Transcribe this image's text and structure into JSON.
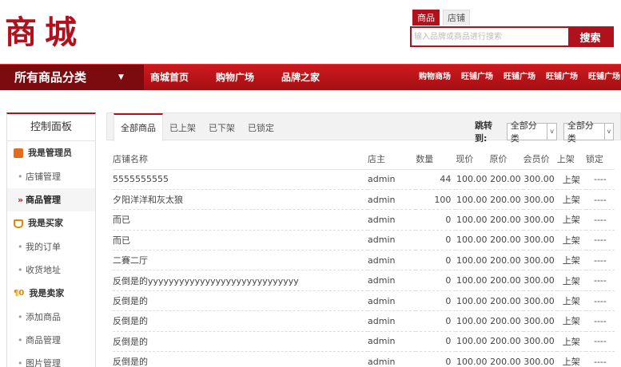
{
  "logo": {
    "text": "商城"
  },
  "search": {
    "tabs": [
      "商品",
      "店铺"
    ],
    "placeholder": "输入品牌或商品进行搜索",
    "button": "搜索"
  },
  "nav": {
    "all_categories": "所有商品分类",
    "main": [
      "商城首页",
      "购物广场",
      "品牌之家"
    ],
    "right": [
      "购物商场",
      "旺铺广场",
      "旺铺广场",
      "旺铺广场",
      "旺铺广场"
    ]
  },
  "sidebar": {
    "title": "控制面板",
    "groups": [
      {
        "label": "我是管理员",
        "icon": "manager-icon",
        "items": [
          "店铺管理",
          "商品管理"
        ]
      },
      {
        "label": "我是买家",
        "icon": "cart-icon",
        "items": [
          "我的订单",
          "收货地址"
        ]
      },
      {
        "label": "我是卖家",
        "icon": "seller-icon",
        "items": [
          "添加商品",
          "商品管理",
          "图片管理"
        ]
      }
    ],
    "active_item": "商品管理"
  },
  "main": {
    "tabs": [
      "全部商品",
      "已上架",
      "已下架",
      "已锁定"
    ],
    "jump_label": "跳转到:",
    "select1": "全部分类",
    "select2": "全部分类",
    "columns": [
      "店铺名称",
      "店主",
      "数量",
      "现价",
      "原价",
      "会员价",
      "上架",
      "锁定"
    ],
    "rows": [
      [
        "5555555555",
        "admin",
        "44",
        "100.00",
        "200.00",
        "300.00",
        "上架",
        "----"
      ],
      [
        "夕阳洋洋和灰太狼",
        "admin",
        "100",
        "100.00",
        "200.00",
        "300.00",
        "上架",
        "----"
      ],
      [
        "而已",
        "admin",
        "0",
        "100.00",
        "200.00",
        "300.00",
        "上架",
        "----"
      ],
      [
        "而已",
        "admin",
        "0",
        "100.00",
        "200.00",
        "300.00",
        "上架",
        "----"
      ],
      [
        "二賽二厅",
        "admin",
        "0",
        "100.00",
        "200.00",
        "300.00",
        "上架",
        "----"
      ],
      [
        "反倒是的yyyyyyyyyyyyyyyyyyyyyyyyyyyyy",
        "admin",
        "0",
        "100.00",
        "200.00",
        "300.00",
        "上架",
        "----"
      ],
      [
        "反倒是的",
        "admin",
        "0",
        "100.00",
        "200.00",
        "300.00",
        "上架",
        "----"
      ],
      [
        "反倒是的",
        "admin",
        "0",
        "100.00",
        "200.00",
        "300.00",
        "上架",
        "----"
      ],
      [
        "反倒是的",
        "admin",
        "0",
        "100.00",
        "200.00",
        "300.00",
        "上架",
        "----"
      ],
      [
        "反倒是的",
        "admin",
        "0",
        "100.00",
        "200.00",
        "300.00",
        "上架",
        "----"
      ]
    ]
  },
  "colors": {
    "brand": "#b0111c",
    "nav_dark": "#7c0b10"
  }
}
